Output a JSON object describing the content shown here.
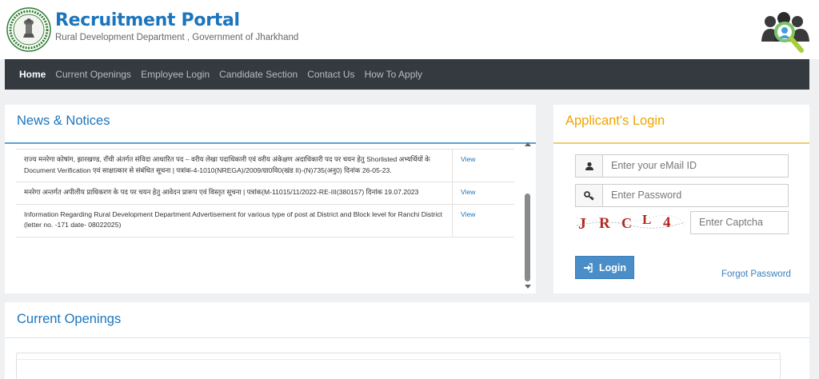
{
  "header": {
    "title": "Recruitment Portal",
    "subtitle": "Rural Development Department , Government of Jharkhand"
  },
  "nav": {
    "items": [
      "Home",
      "Current Openings",
      "Employee Login",
      "Candidate Section",
      "Contact Us",
      "How To Apply"
    ],
    "active": "Home"
  },
  "news": {
    "title": "News & Notices",
    "items": [
      {
        "text": "राज्य मनरेगा कोषांग, झारखण्ड, राँची अंतर्गत संविदा आधारित पद – वरीय लेखा पदाधिकारी एवं वरीय अंकेक्षण अदाधिकारी पद पर चयन हेतु Shorlisted अभ्यर्थियों के Document Verification एवं साक्षात्कार से संबंधित सूचना | पत्रांक-4-1010(NREGA)/2009/ग्रा0वि0(खंड II)-(N)735(अनु0) दिनांक 26-05-23.",
        "link": "View"
      },
      {
        "text": "मनरेगा अन्तर्गत अपीलीय प्राधिकरण के पद पर चयन हेतु आवेदन प्रारूप एवं विस्तृत सूचना | पत्रांक(M-11015/11/2022-RE-III(380157) दिनांक 19.07.2023",
        "link": "View"
      },
      {
        "text": "Information Regarding Rural Development Department Advertisement for various type of post at District and Block level for Ranchi District (letter no. -171 date- 08022025)",
        "link": "View"
      }
    ]
  },
  "login": {
    "title": "Applicant's Login",
    "email_placeholder": "Enter your eMail ID",
    "password_placeholder": "Enter Password",
    "captcha_text": "JRCL4",
    "captcha_placeholder": "Enter Captcha",
    "login_label": "Login",
    "forgot_label": "Forgot Password"
  },
  "openings": {
    "title": "Current Openings"
  },
  "colors": {
    "brand_blue": "#1c75bc",
    "nav_bg": "#343a40",
    "login_accent": "#f1a400",
    "button_blue": "#4a8ec9"
  },
  "icons": {
    "emblem": "jharkhand-emblem-icon",
    "people": "people-search-icon",
    "user": "user-icon",
    "key": "key-icon",
    "login": "sign-in-icon"
  }
}
